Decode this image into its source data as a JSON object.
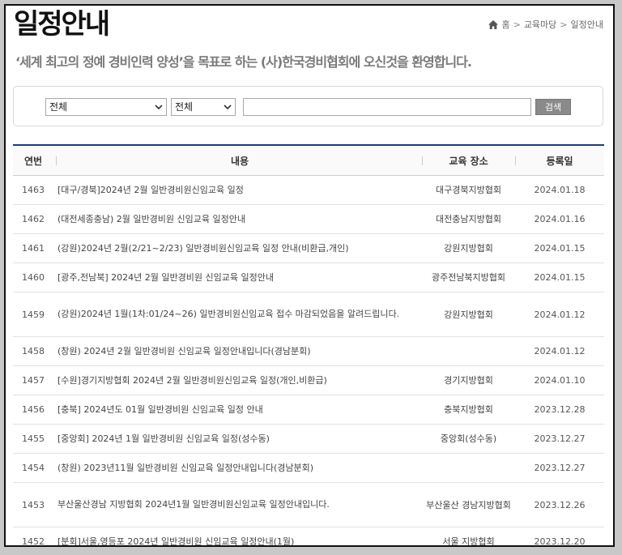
{
  "page": {
    "title": "일정안내",
    "subtitle": "‘세계 최고의 정예 경비인력 양성’을 목표로 하는 (사)한국경비협회에 오신것을 환영합니다."
  },
  "breadcrumb": {
    "home": "홈",
    "section": "교육마당",
    "current": "일정안내"
  },
  "search": {
    "category_value": "전체",
    "field_value": "전체",
    "keyword_value": "",
    "button_label": "검색"
  },
  "table": {
    "headers": {
      "no": "연번",
      "title": "내용",
      "place": "교육 장소",
      "date": "등록일"
    },
    "rows": [
      {
        "no": "1463",
        "title": "[대구/경북]2024년 2월 일반경비원신임교육 일정",
        "place": "대구경북지방협회",
        "date": "2024.01.18"
      },
      {
        "no": "1462",
        "title": "(대전세종충남) 2월 일반경비원 신임교육 일정안내",
        "place": "대전충남지방협회",
        "date": "2024.01.16"
      },
      {
        "no": "1461",
        "title": "(강원)2024년 2월(2/21~2/23) 일반경비원신임교육 일정 안내(비환급,개인)",
        "place": "강원지방협회",
        "date": "2024.01.15"
      },
      {
        "no": "1460",
        "title": "[광주,전남북] 2024년 2월 일반경비원 신임교육 일정안내",
        "place": "광주전남북지방협회",
        "date": "2024.01.15"
      },
      {
        "no": "1459",
        "title": "(강원)2024년 1월(1차:01/24~26) 일반경비원신임교육 접수 마감되었음을 알려드립니다.",
        "place": "강원지방협회",
        "date": "2024.01.12"
      },
      {
        "no": "1458",
        "title": "(창원) 2024년 2월 일반경비원 신임교육 일정안내입니다(경남분회)",
        "place": "",
        "date": "2024.01.12"
      },
      {
        "no": "1457",
        "title": "[수원]경기지방협회 2024년 2월 일반경비원신임교육 일정(개인,비환급)",
        "place": "경기지방협회",
        "date": "2024.01.10"
      },
      {
        "no": "1456",
        "title": "[충북] 2024년도 01월 일반경비원 신임교육 일정 안내",
        "place": "충북지방협회",
        "date": "2023.12.28"
      },
      {
        "no": "1455",
        "title": "[중앙회] 2024년 1월 일반경비원 신임교육 일정(성수동)",
        "place": "중앙회(성수동)",
        "date": "2023.12.27"
      },
      {
        "no": "1454",
        "title": "(창원) 2023년11월 일반경비원 신임교육 일정안내입니다(경남분회)",
        "place": "",
        "date": "2023.12.27"
      },
      {
        "no": "1453",
        "title": "부산울산경남 지방협회 2024년1월 일반경비원신임교육 일정안내입니다.",
        "place": "부산울산 경남지방협회",
        "date": "2023.12.26"
      },
      {
        "no": "1452",
        "title": "[분회]서울,영등포 2024년 일반경비원 신임교육 일정안내(1월)",
        "place": "서울 지방협회",
        "date": "2023.12.20"
      }
    ]
  },
  "icons": {
    "home": "home-icon",
    "separator": "chevron-right-icon",
    "dropdown": "chevron-down-icon"
  },
  "colors": {
    "table_top_border": "#1d3c78",
    "search_button": "#8a8a8a",
    "subtitle": "#7a7a7a"
  }
}
